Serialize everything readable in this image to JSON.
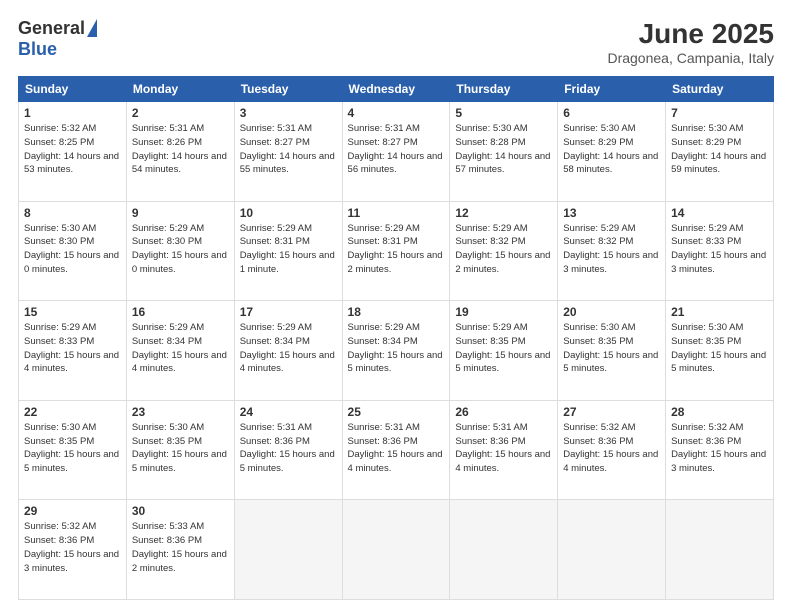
{
  "header": {
    "logo_general": "General",
    "logo_blue": "Blue",
    "month_title": "June 2025",
    "location": "Dragonea, Campania, Italy"
  },
  "days_of_week": [
    "Sunday",
    "Monday",
    "Tuesday",
    "Wednesday",
    "Thursday",
    "Friday",
    "Saturday"
  ],
  "weeks": [
    [
      {
        "num": "1",
        "info": "Sunrise: 5:32 AM\nSunset: 8:25 PM\nDaylight: 14 hours\nand 53 minutes."
      },
      {
        "num": "2",
        "info": "Sunrise: 5:31 AM\nSunset: 8:26 PM\nDaylight: 14 hours\nand 54 minutes."
      },
      {
        "num": "3",
        "info": "Sunrise: 5:31 AM\nSunset: 8:27 PM\nDaylight: 14 hours\nand 55 minutes."
      },
      {
        "num": "4",
        "info": "Sunrise: 5:31 AM\nSunset: 8:27 PM\nDaylight: 14 hours\nand 56 minutes."
      },
      {
        "num": "5",
        "info": "Sunrise: 5:30 AM\nSunset: 8:28 PM\nDaylight: 14 hours\nand 57 minutes."
      },
      {
        "num": "6",
        "info": "Sunrise: 5:30 AM\nSunset: 8:29 PM\nDaylight: 14 hours\nand 58 minutes."
      },
      {
        "num": "7",
        "info": "Sunrise: 5:30 AM\nSunset: 8:29 PM\nDaylight: 14 hours\nand 59 minutes."
      }
    ],
    [
      {
        "num": "8",
        "info": "Sunrise: 5:30 AM\nSunset: 8:30 PM\nDaylight: 15 hours\nand 0 minutes."
      },
      {
        "num": "9",
        "info": "Sunrise: 5:29 AM\nSunset: 8:30 PM\nDaylight: 15 hours\nand 0 minutes."
      },
      {
        "num": "10",
        "info": "Sunrise: 5:29 AM\nSunset: 8:31 PM\nDaylight: 15 hours\nand 1 minute."
      },
      {
        "num": "11",
        "info": "Sunrise: 5:29 AM\nSunset: 8:31 PM\nDaylight: 15 hours\nand 2 minutes."
      },
      {
        "num": "12",
        "info": "Sunrise: 5:29 AM\nSunset: 8:32 PM\nDaylight: 15 hours\nand 2 minutes."
      },
      {
        "num": "13",
        "info": "Sunrise: 5:29 AM\nSunset: 8:32 PM\nDaylight: 15 hours\nand 3 minutes."
      },
      {
        "num": "14",
        "info": "Sunrise: 5:29 AM\nSunset: 8:33 PM\nDaylight: 15 hours\nand 3 minutes."
      }
    ],
    [
      {
        "num": "15",
        "info": "Sunrise: 5:29 AM\nSunset: 8:33 PM\nDaylight: 15 hours\nand 4 minutes."
      },
      {
        "num": "16",
        "info": "Sunrise: 5:29 AM\nSunset: 8:34 PM\nDaylight: 15 hours\nand 4 minutes."
      },
      {
        "num": "17",
        "info": "Sunrise: 5:29 AM\nSunset: 8:34 PM\nDaylight: 15 hours\nand 4 minutes."
      },
      {
        "num": "18",
        "info": "Sunrise: 5:29 AM\nSunset: 8:34 PM\nDaylight: 15 hours\nand 5 minutes."
      },
      {
        "num": "19",
        "info": "Sunrise: 5:29 AM\nSunset: 8:35 PM\nDaylight: 15 hours\nand 5 minutes."
      },
      {
        "num": "20",
        "info": "Sunrise: 5:30 AM\nSunset: 8:35 PM\nDaylight: 15 hours\nand 5 minutes."
      },
      {
        "num": "21",
        "info": "Sunrise: 5:30 AM\nSunset: 8:35 PM\nDaylight: 15 hours\nand 5 minutes."
      }
    ],
    [
      {
        "num": "22",
        "info": "Sunrise: 5:30 AM\nSunset: 8:35 PM\nDaylight: 15 hours\nand 5 minutes."
      },
      {
        "num": "23",
        "info": "Sunrise: 5:30 AM\nSunset: 8:35 PM\nDaylight: 15 hours\nand 5 minutes."
      },
      {
        "num": "24",
        "info": "Sunrise: 5:31 AM\nSunset: 8:36 PM\nDaylight: 15 hours\nand 5 minutes."
      },
      {
        "num": "25",
        "info": "Sunrise: 5:31 AM\nSunset: 8:36 PM\nDaylight: 15 hours\nand 4 minutes."
      },
      {
        "num": "26",
        "info": "Sunrise: 5:31 AM\nSunset: 8:36 PM\nDaylight: 15 hours\nand 4 minutes."
      },
      {
        "num": "27",
        "info": "Sunrise: 5:32 AM\nSunset: 8:36 PM\nDaylight: 15 hours\nand 4 minutes."
      },
      {
        "num": "28",
        "info": "Sunrise: 5:32 AM\nSunset: 8:36 PM\nDaylight: 15 hours\nand 3 minutes."
      }
    ],
    [
      {
        "num": "29",
        "info": "Sunrise: 5:32 AM\nSunset: 8:36 PM\nDaylight: 15 hours\nand 3 minutes."
      },
      {
        "num": "30",
        "info": "Sunrise: 5:33 AM\nSunset: 8:36 PM\nDaylight: 15 hours\nand 2 minutes."
      },
      {
        "num": "",
        "info": ""
      },
      {
        "num": "",
        "info": ""
      },
      {
        "num": "",
        "info": ""
      },
      {
        "num": "",
        "info": ""
      },
      {
        "num": "",
        "info": ""
      }
    ]
  ]
}
